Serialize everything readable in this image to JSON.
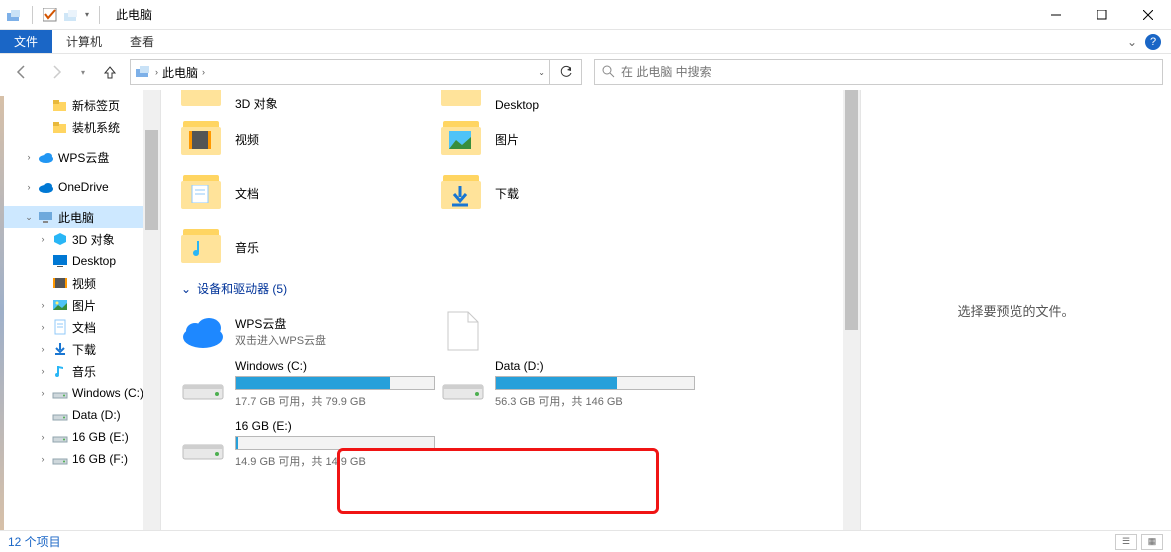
{
  "window": {
    "title": "此电脑"
  },
  "ribbon": {
    "file": "文件",
    "tabs": [
      "计算机",
      "查看"
    ]
  },
  "nav": {
    "location": "此电脑",
    "search_placeholder": "在 此电脑 中搜索"
  },
  "sidebar": [
    {
      "level": 2,
      "label": "新标签页",
      "icon": "folder",
      "twisty": ""
    },
    {
      "level": 2,
      "label": "装机系统",
      "icon": "folder",
      "twisty": ""
    },
    {
      "level": 1,
      "label": "WPS云盘",
      "icon": "cloud-wps",
      "twisty": ">"
    },
    {
      "level": 1,
      "label": "OneDrive",
      "icon": "cloud-od",
      "twisty": ">"
    },
    {
      "level": 1,
      "label": "此电脑",
      "icon": "thispc",
      "twisty": "v",
      "selected": true
    },
    {
      "level": 2,
      "label": "3D 对象",
      "icon": "3d",
      "twisty": ">"
    },
    {
      "level": 2,
      "label": "Desktop",
      "icon": "desktop",
      "twisty": ""
    },
    {
      "level": 2,
      "label": "视频",
      "icon": "video",
      "twisty": ""
    },
    {
      "level": 2,
      "label": "图片",
      "icon": "pictures",
      "twisty": ">"
    },
    {
      "level": 2,
      "label": "文档",
      "icon": "docs",
      "twisty": ">"
    },
    {
      "level": 2,
      "label": "下载",
      "icon": "downloads",
      "twisty": ">"
    },
    {
      "level": 2,
      "label": "音乐",
      "icon": "music",
      "twisty": ">"
    },
    {
      "level": 2,
      "label": "Windows (C:)",
      "icon": "drive",
      "twisty": ">"
    },
    {
      "level": 2,
      "label": "Data (D:)",
      "icon": "drive",
      "twisty": ""
    },
    {
      "level": 2,
      "label": "16 GB (E:)",
      "icon": "drive",
      "twisty": ">"
    },
    {
      "level": 2,
      "label": "16 GB (F:)",
      "icon": "drive",
      "twisty": ">"
    }
  ],
  "folders_row1": [
    {
      "label": "3D 对象"
    },
    {
      "label": "Desktop"
    }
  ],
  "folders": [
    {
      "label": "视频",
      "overlay": "video"
    },
    {
      "label": "图片",
      "overlay": "pictures"
    },
    {
      "label": "文档",
      "overlay": "docs"
    },
    {
      "label": "下载",
      "overlay": "downloads"
    },
    {
      "label": "音乐",
      "overlay": "music"
    }
  ],
  "group_devices": {
    "title": "设备和驱动器 (5)"
  },
  "cloud_row": [
    {
      "name": "WPS云盘",
      "sub": "双击进入WPS云盘",
      "icon": "cloud"
    },
    {
      "name": "",
      "sub": "",
      "icon": "file"
    }
  ],
  "drives": [
    {
      "name": "Windows (C:)",
      "sub": "17.7 GB 可用，共 79.9 GB",
      "fill_css": "78%"
    },
    {
      "name": "Data (D:)",
      "sub": "56.3 GB 可用，共 146 GB",
      "fill_css": "61%"
    },
    {
      "name": "16 GB (E:)",
      "sub": "14.9 GB 可用，共 14.9 GB",
      "fill_css": "1%"
    }
  ],
  "preview": {
    "text": "选择要预览的文件。"
  },
  "status": {
    "text": "12 个项目"
  }
}
